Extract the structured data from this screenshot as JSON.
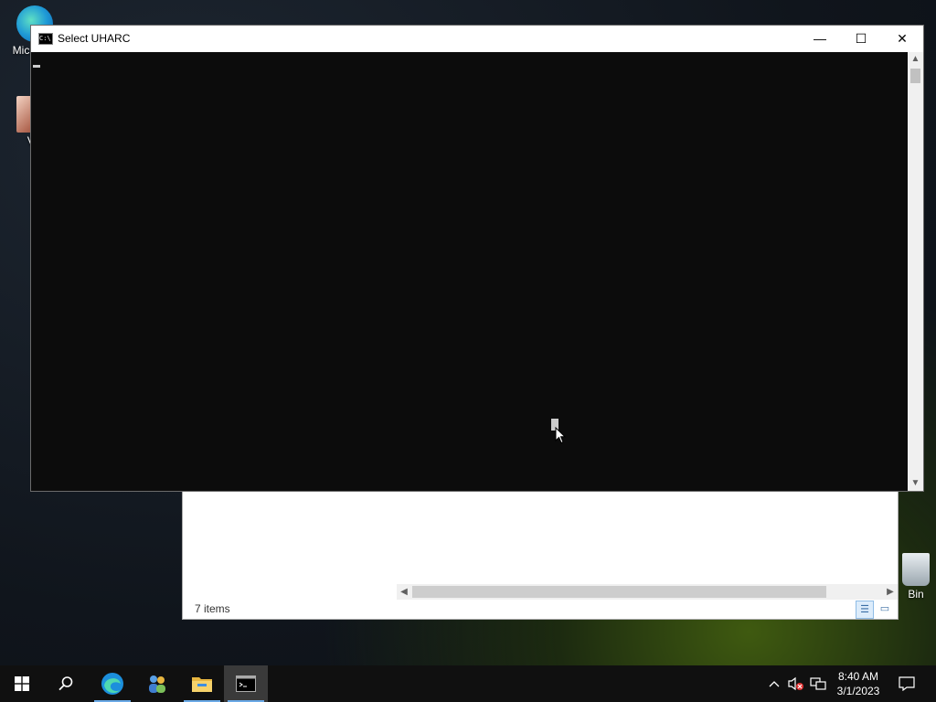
{
  "desktop": {
    "icons": [
      {
        "label": "Mic… Ed",
        "name": "Microsoft Edge"
      },
      {
        "label": "Vic",
        "name": "Video"
      },
      {
        "label": "Bin",
        "name": "Recycle Bin"
      }
    ]
  },
  "console_window": {
    "title": "Select UHARC",
    "minimize_symbol": "—",
    "maximize_symbol": "☐",
    "close_symbol": "✕"
  },
  "explorer_window": {
    "status_text": "7 items"
  },
  "taskbar": {
    "clock_time": "8:40 AM",
    "clock_date": "3/1/2023",
    "pinned": [
      "start",
      "search",
      "edge",
      "people",
      "file-explorer",
      "command-prompt"
    ]
  },
  "colors": {
    "console_bg": "#0c0c0c",
    "taskbar_bg": "#101010",
    "accent": "#6aa9e6"
  }
}
